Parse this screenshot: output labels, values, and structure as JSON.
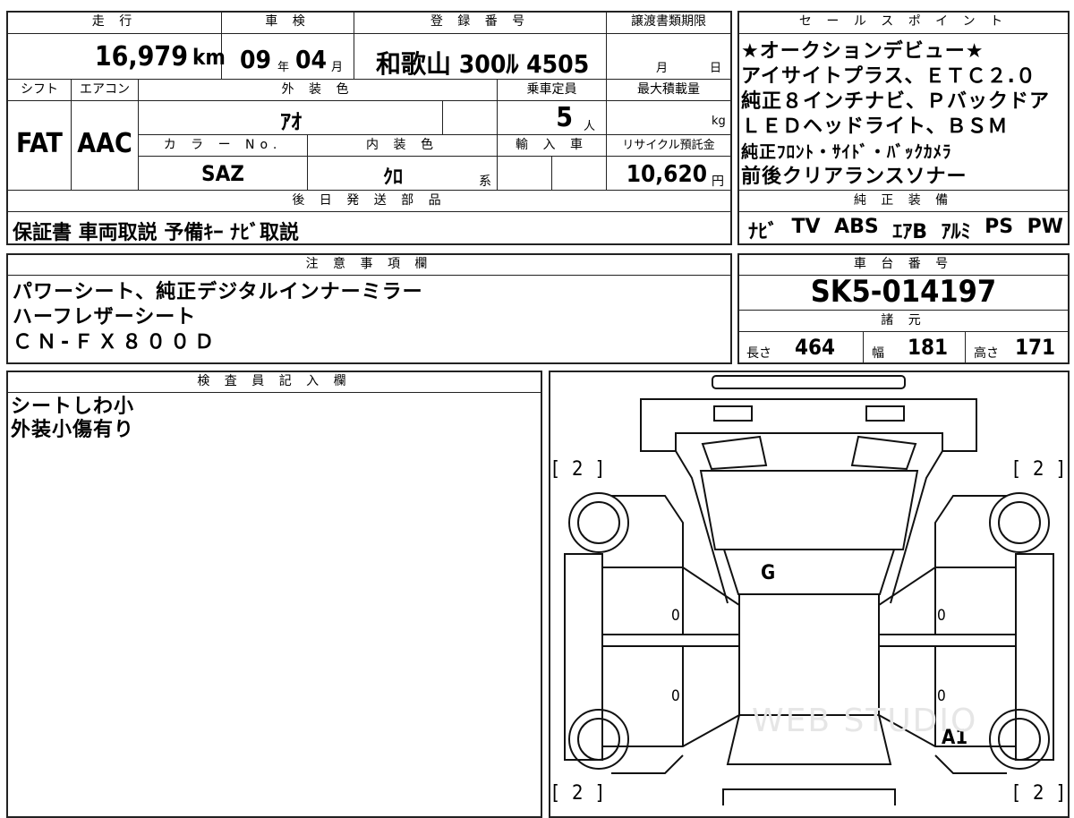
{
  "top": {
    "mileage_label": "走 行",
    "mileage_value": "16,979",
    "mileage_unit": "km",
    "inspection_label": "車 検",
    "inspection_year": "09",
    "inspection_year_unit": "年",
    "inspection_month": "04",
    "inspection_month_unit": "月",
    "registration_label": "登 録 番 号",
    "registration_value": "和歌山 300ﾙ 4505",
    "transfer_label": "譲渡書類期限",
    "transfer_month_unit": "月",
    "transfer_day_unit": "日"
  },
  "row2": {
    "shift_label": "シフト",
    "ac_label": "エアコン",
    "shift_value": "FAT",
    "ac_value": "AAC",
    "exterior_label": "外 装 色",
    "exterior_value": "ｱｵ",
    "capacity_label": "乗車定員",
    "capacity_value": "5",
    "capacity_unit": "人",
    "maxload_label": "最大積載量",
    "maxload_unit": "kg",
    "color_no_label": "カ ラ ー No.",
    "color_no_value": "SAZ",
    "interior_label": "内 装 色",
    "interior_value": "ｸﾛ",
    "interior_suffix": "系",
    "import_label": "輸 入 車",
    "recycle_label": "リサイクル預託金",
    "recycle_value": "10,620",
    "recycle_unit": "円"
  },
  "later_parts": {
    "label": "後 日 発 送 部 品",
    "value": "保証書 車両取説 予備ｷｰ ﾅﾋﾞ取説"
  },
  "sales_points": {
    "label": "セ ー ル ス ポ イ ン ト",
    "lines": [
      "★オークションデビュー★",
      "アイサイトプラス、ＥＴＣ２.０",
      "純正８インチナビ、Ｐバックドア",
      "ＬＥＤヘッドライト、ＢＳＭ",
      "純正ﾌﾛﾝﾄ・ｻｲﾄﾞ・ﾊﾞｯｸｶﾒﾗ",
      "前後クリアランスソナー"
    ]
  },
  "equipment": {
    "label": "純 正 装 備",
    "items": [
      "ﾅﾋﾞ",
      "TV",
      "ABS",
      "ｴｱB",
      "ｱﾙﾐ",
      "PS",
      "PW"
    ]
  },
  "notes": {
    "label": "注 意 事 項 欄",
    "lines": [
      "パワーシート、純正デジタルインナーミラー",
      "ハーフレザーシート",
      "ＣＮ-ＦＸ８００Ｄ"
    ]
  },
  "chassis": {
    "label": "車 台 番 号",
    "value": "SK5-014197",
    "specs_label": "諸 元",
    "length_label": "長さ",
    "length_value": "464",
    "width_label": "幅",
    "width_value": "181",
    "height_label": "高さ",
    "height_value": "171"
  },
  "inspector": {
    "label": "検 査 員 記 入 欄",
    "lines": [
      "シートしわ小",
      "外装小傷有り"
    ]
  },
  "diagram": {
    "tire_front_left": "[ 2 ]",
    "tire_front_right": "[ 2 ]",
    "tire_rear_left": "[ 2 ]",
    "tire_rear_right": "[ 2 ]",
    "mark_roof": "G",
    "mark_door_fl": "0",
    "mark_door_fr": "0",
    "mark_door_rl": "0",
    "mark_door_rr": "0",
    "mark_rear_right": "A1",
    "watermark": "WEB STUDIO"
  }
}
